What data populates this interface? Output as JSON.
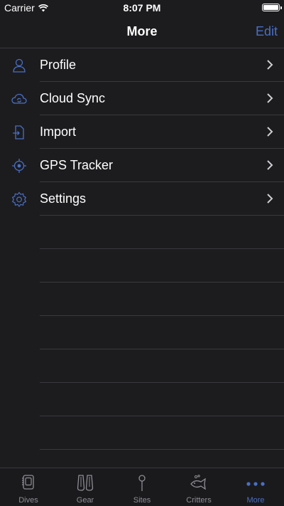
{
  "status": {
    "carrier": "Carrier",
    "time": "8:07 PM"
  },
  "nav": {
    "title": "More",
    "edit_label": "Edit"
  },
  "menu": [
    {
      "label": "Profile",
      "icon": "person-icon"
    },
    {
      "label": "Cloud Sync",
      "icon": "cloud-sync-icon"
    },
    {
      "label": "Import",
      "icon": "import-icon"
    },
    {
      "label": "GPS Tracker",
      "icon": "gps-target-icon"
    },
    {
      "label": "Settings",
      "icon": "gear-icon"
    }
  ],
  "tabs": [
    {
      "label": "Dives",
      "icon": "dive-log-icon",
      "active": false
    },
    {
      "label": "Gear",
      "icon": "fins-icon",
      "active": false
    },
    {
      "label": "Sites",
      "icon": "pin-icon",
      "active": false
    },
    {
      "label": "Critters",
      "icon": "fish-icon",
      "active": false
    },
    {
      "label": "More",
      "icon": "more-dots-icon",
      "active": true
    }
  ],
  "colors": {
    "accent": "#4a6fc4",
    "background": "#1c1c1f",
    "separator": "#3a3a3e",
    "icon": "#4a6fc4",
    "tab_inactive": "#8e8e93"
  }
}
